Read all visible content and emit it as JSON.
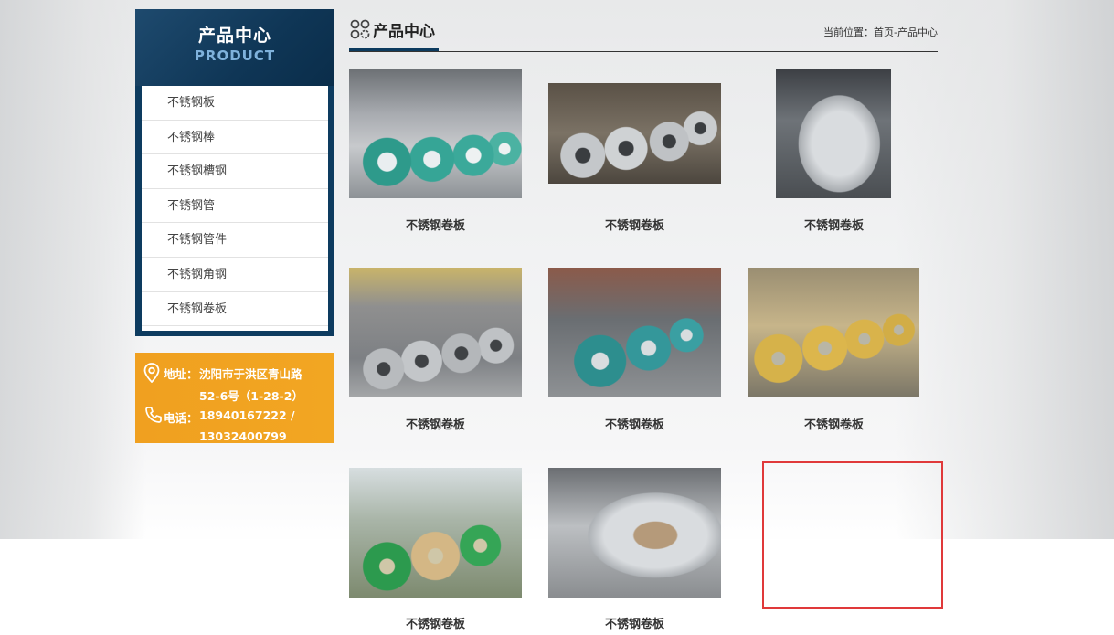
{
  "sidebar": {
    "title": "产品中心",
    "subtitle": "PRODUCT",
    "items": [
      {
        "label": "不锈钢板"
      },
      {
        "label": "不锈钢棒"
      },
      {
        "label": "不锈钢槽钢"
      },
      {
        "label": "不锈钢管"
      },
      {
        "label": "不锈钢管件"
      },
      {
        "label": "不锈钢角钢"
      },
      {
        "label": "不锈钢卷板"
      }
    ]
  },
  "contact": {
    "address_label": "地址：",
    "address_line1": "沈阳市于洪区青山路",
    "address_line2": "52-6号（1-28-2）",
    "phone_label": "电话：",
    "phone_line1": "18940167222 /",
    "phone_line2": "13032400799",
    "icons": [
      "location-pin-icon",
      "phone-icon"
    ]
  },
  "main": {
    "title": "产品中心",
    "icon": "grid-gear-icon",
    "breadcrumb": {
      "prefix": "当前位置：",
      "home": "首页",
      "separator": "-",
      "current": "产品中心"
    },
    "products": [
      {
        "caption": "不锈钢卷板"
      },
      {
        "caption": "不锈钢卷板"
      },
      {
        "caption": "不锈钢卷板"
      },
      {
        "caption": "不锈钢卷板"
      },
      {
        "caption": "不锈钢卷板"
      },
      {
        "caption": "不锈钢卷板"
      },
      {
        "caption": "不锈钢卷板"
      },
      {
        "caption": "不锈钢卷板"
      }
    ]
  },
  "colors": {
    "sidebar_bg": "#0d3b5f",
    "sidebar_subtitle": "#7fb2dc",
    "contact_bg": "#f0a020",
    "highlight": "#e0393a"
  }
}
